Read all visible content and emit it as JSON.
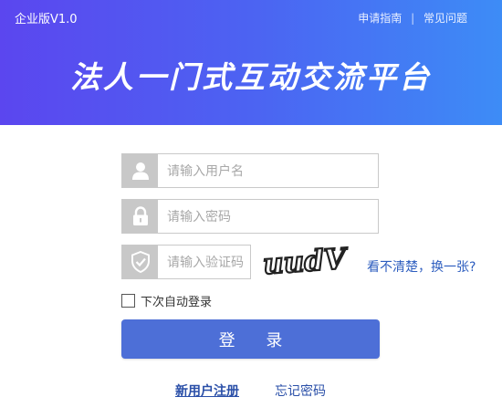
{
  "header": {
    "version": "企业版V1.0",
    "links": [
      "申请指南",
      "常见问题"
    ],
    "separator": "|",
    "title": "法人一门式互动交流平台"
  },
  "form": {
    "username_placeholder": "请输入用户名",
    "password_placeholder": "请输入密码",
    "captcha_placeholder": "请输入验证码",
    "captcha_text": "uudV",
    "refresh_label": "看不清楚，换一张?",
    "remember_label": "下次自动登录",
    "remember_checked": false,
    "login_label": "登 录",
    "register_label": "新用户注册",
    "forgot_label": "忘记密码"
  },
  "colors": {
    "header_gradient_start": "#5b46ef",
    "header_gradient_end": "#3d8cf6",
    "login_button": "#4d6fd7",
    "link": "#2a4fa8"
  },
  "icons": [
    "user-icon",
    "lock-icon",
    "shield-check-icon"
  ]
}
